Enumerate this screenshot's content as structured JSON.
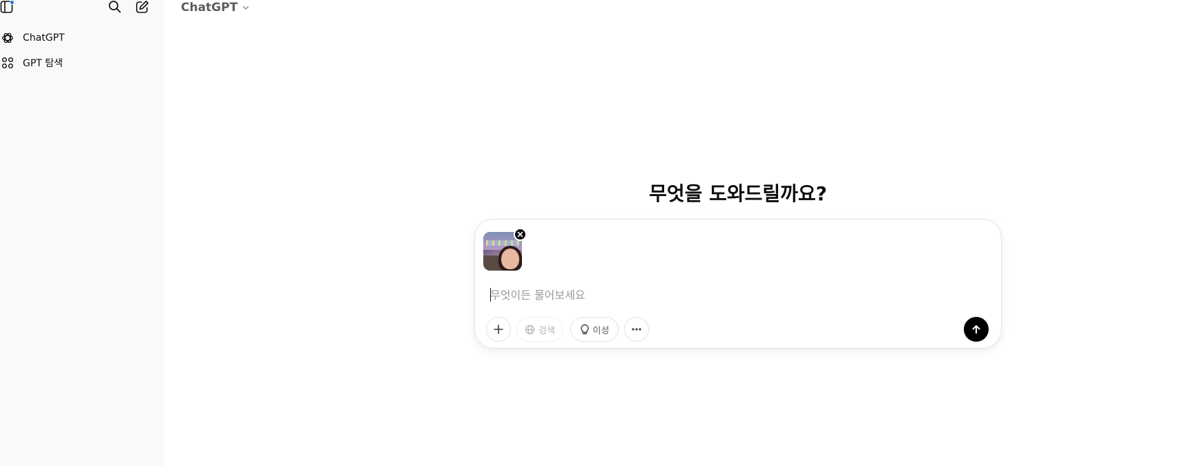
{
  "sidebar": {
    "items": [
      {
        "label": "ChatGPT",
        "icon": "openai-logo-icon"
      },
      {
        "label": "GPT 탐색",
        "icon": "grid-icon"
      }
    ],
    "notification_color": "#1a73e8"
  },
  "header": {
    "model_label": "ChatGPT"
  },
  "main": {
    "headline": "무엇을 도와드릴까요?",
    "composer": {
      "placeholder": "무엇이든 물어보세요",
      "value": "",
      "attachment": {
        "type": "image",
        "icon": "close-icon"
      },
      "tools": {
        "search_label": "검색",
        "reason_label": "이성"
      },
      "send_color": "#000000"
    }
  }
}
